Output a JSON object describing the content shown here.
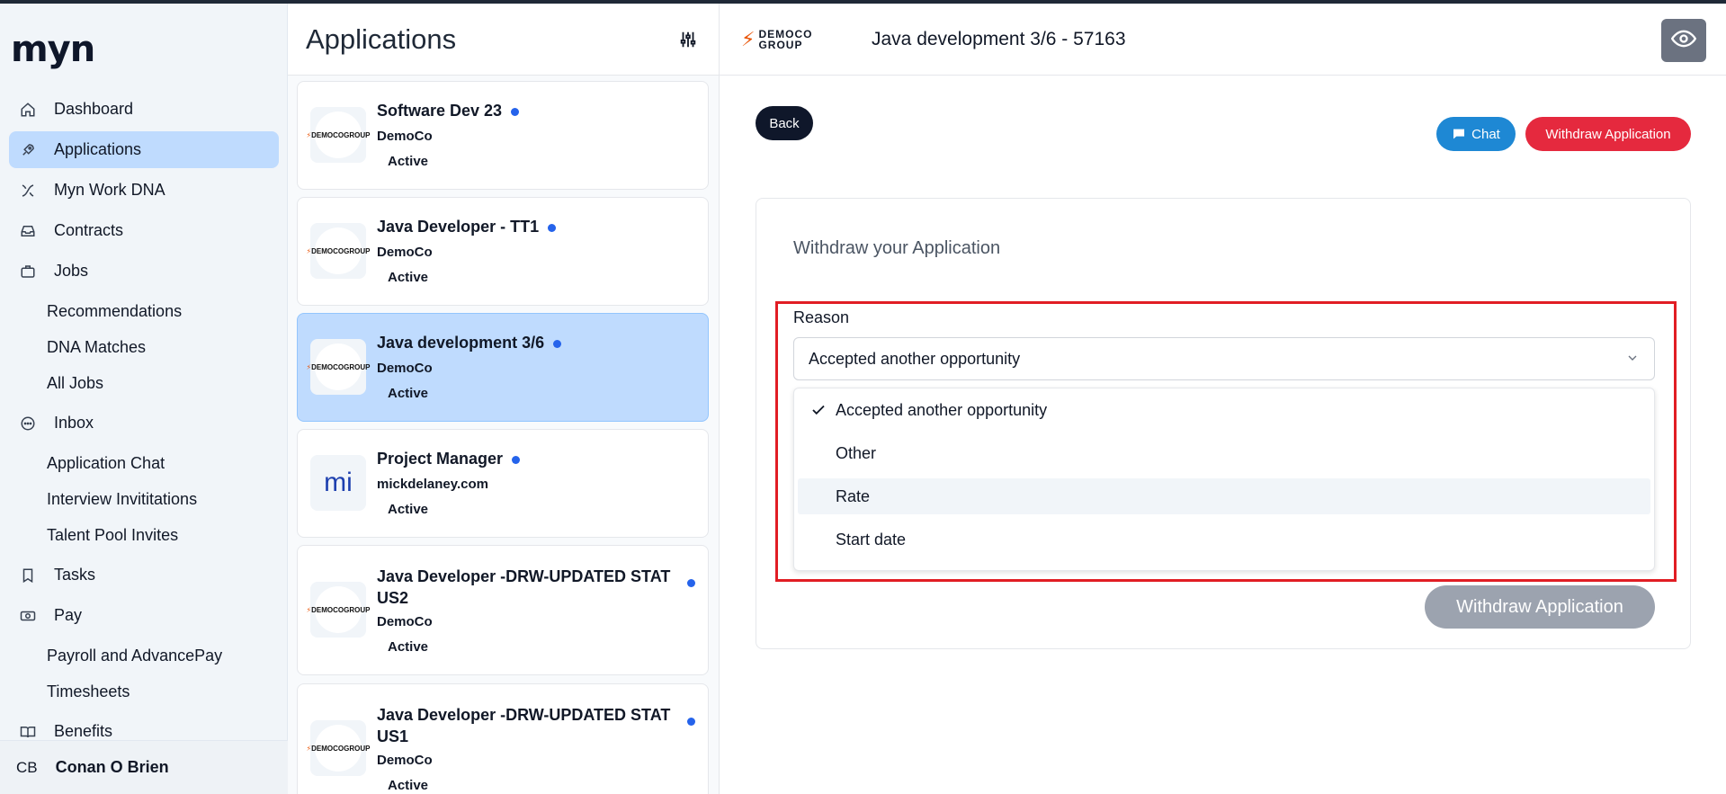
{
  "sidebar": {
    "logo": "myn",
    "items": [
      {
        "label": "Dashboard",
        "icon": "home-icon"
      },
      {
        "label": "Applications",
        "icon": "rocket-icon"
      },
      {
        "label": "Myn Work DNA",
        "icon": "dna-icon"
      },
      {
        "label": "Contracts",
        "icon": "inbox-tray-icon"
      },
      {
        "label": "Jobs",
        "icon": "briefcase-icon"
      },
      {
        "label": "Recommendations"
      },
      {
        "label": "DNA Matches"
      },
      {
        "label": "All Jobs"
      },
      {
        "label": "Inbox",
        "icon": "chat-icon"
      },
      {
        "label": "Application Chat"
      },
      {
        "label": "Interview Invititations"
      },
      {
        "label": "Talent Pool Invites"
      },
      {
        "label": "Tasks",
        "icon": "bookmark-icon"
      },
      {
        "label": "Pay",
        "icon": "money-icon"
      },
      {
        "label": "Payroll and AdvancePay"
      },
      {
        "label": "Timesheets"
      },
      {
        "label": "Benefits",
        "icon": "book-icon"
      }
    ],
    "profile": {
      "initials": "CB",
      "name": "Conan O Brien"
    }
  },
  "apps_panel": {
    "title": "Applications",
    "cards": [
      {
        "title": "Software Dev 23",
        "company": "DemoCo",
        "status": "Active"
      },
      {
        "title": "Java Developer - TT1",
        "company": "DemoCo",
        "status": "Active"
      },
      {
        "title": "Java development 3/6",
        "company": "DemoCo",
        "status": "Active"
      },
      {
        "title": "Project Manager",
        "company": "mickdelaney.com",
        "status": "Active",
        "logo_text": "mi"
      },
      {
        "title_line1": "Java Developer -DRW-UPDATED STAT",
        "title_line2": "US2",
        "company": "DemoCo",
        "status": "Active"
      },
      {
        "title_line1": "Java Developer -DRW-UPDATED STAT",
        "title_line2": "US1",
        "company": "DemoCo",
        "status": "Active"
      }
    ],
    "logo_text": {
      "line1": "DEMOCO",
      "line2": "GROUP"
    }
  },
  "main": {
    "brand": {
      "line1": "DEMOCO",
      "line2": "GROUP"
    },
    "title": "Java development 3/6 - 57163",
    "back_label": "Back",
    "chat_label": "Chat",
    "withdraw_top_label": "Withdraw Application",
    "form": {
      "heading": "Withdraw your Application",
      "reason_label": "Reason",
      "selected": "Accepted another opportunity",
      "options": [
        "Accepted another opportunity",
        "Other",
        "Rate",
        "Start date"
      ],
      "submit_label": "Withdraw Application"
    }
  },
  "colors": {
    "active_nav": "#bfdbfe",
    "chat_button": "#1e88d4",
    "withdraw_button": "#e5293e",
    "highlight_border": "#e11d24",
    "unread_dot": "#2563eb"
  }
}
